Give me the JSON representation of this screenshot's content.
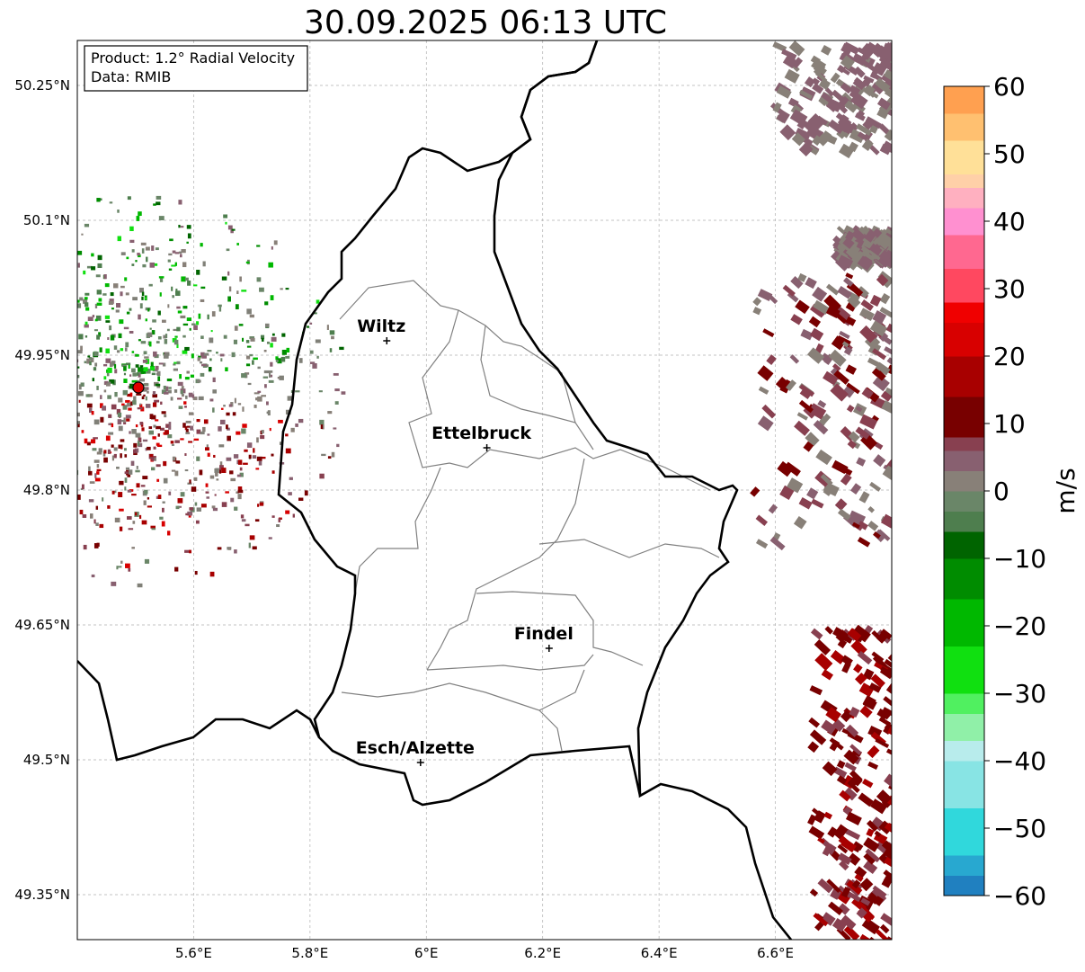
{
  "title": "30.09.2025 06:13 UTC",
  "info_box": {
    "product": "Product: 1.2° Radial Velocity",
    "data": "Data: RMIB"
  },
  "lat_ticks": [
    {
      "value": 50.25,
      "label": "50.25°N"
    },
    {
      "value": 50.1,
      "label": "50.1°N"
    },
    {
      "value": 49.95,
      "label": "49.95°N"
    },
    {
      "value": 49.8,
      "label": "49.8°N"
    },
    {
      "value": 49.65,
      "label": "49.65°N"
    },
    {
      "value": 49.5,
      "label": "49.5°N"
    },
    {
      "value": 49.35,
      "label": "49.35°N"
    }
  ],
  "lon_ticks": [
    {
      "value": 5.6,
      "label": "5.6°E"
    },
    {
      "value": 5.8,
      "label": "5.8°E"
    },
    {
      "value": 6.0,
      "label": "6°E"
    },
    {
      "value": 6.2,
      "label": "6.2°E"
    },
    {
      "value": 6.4,
      "label": "6.4°E"
    },
    {
      "value": 6.6,
      "label": "6.6°E"
    }
  ],
  "extent": {
    "lon": [
      5.4,
      6.8
    ],
    "lat": [
      49.3,
      50.3
    ]
  },
  "cities": [
    {
      "name": "Wiltz",
      "lon": 5.932,
      "lat": 49.966
    },
    {
      "name": "Ettelbruck",
      "lon": 6.104,
      "lat": 49.847
    },
    {
      "name": "Findel",
      "lon": 6.211,
      "lat": 49.624
    },
    {
      "name": "Esch/Alzette",
      "lon": 5.99,
      "lat": 49.497
    }
  ],
  "radar_site": {
    "lon": 5.505,
    "lat": 49.914
  },
  "colorbar": {
    "label": "m/s",
    "min": -60,
    "max": 60,
    "ticks": [
      {
        "value": 60,
        "label": "60"
      },
      {
        "value": 50,
        "label": "50"
      },
      {
        "value": 40,
        "label": "40"
      },
      {
        "value": 30,
        "label": "30"
      },
      {
        "value": 20,
        "label": "20"
      },
      {
        "value": 10,
        "label": "10"
      },
      {
        "value": 0,
        "label": "0"
      },
      {
        "value": -10,
        "label": "−10"
      },
      {
        "value": -20,
        "label": "−20"
      },
      {
        "value": -30,
        "label": "−30"
      },
      {
        "value": -40,
        "label": "−40"
      },
      {
        "value": -50,
        "label": "−50"
      },
      {
        "value": -60,
        "label": "−60"
      }
    ],
    "bands": [
      {
        "from": -60,
        "to": -57,
        "color": "#2080c0"
      },
      {
        "from": -57,
        "to": -54,
        "color": "#28a8d0"
      },
      {
        "from": -54,
        "to": -47,
        "color": "#30d8dc"
      },
      {
        "from": -47,
        "to": -40,
        "color": "#88e4e4"
      },
      {
        "from": -40,
        "to": -37,
        "color": "#b8ecec"
      },
      {
        "from": -37,
        "to": -33,
        "color": "#90f0a8"
      },
      {
        "from": -33,
        "to": -30,
        "color": "#50f060"
      },
      {
        "from": -30,
        "to": -23,
        "color": "#10e010"
      },
      {
        "from": -23,
        "to": -16,
        "color": "#00b800"
      },
      {
        "from": -16,
        "to": -10,
        "color": "#008c00"
      },
      {
        "from": -10,
        "to": -6,
        "color": "#006400"
      },
      {
        "from": -6,
        "to": -3,
        "color": "#4e7e4e"
      },
      {
        "from": -3,
        "to": 0,
        "color": "#6a8668"
      },
      {
        "from": 0,
        "to": 3,
        "color": "#888078"
      },
      {
        "from": 3,
        "to": 6,
        "color": "#886070"
      },
      {
        "from": 6,
        "to": 8,
        "color": "#884050"
      },
      {
        "from": 8,
        "to": 14,
        "color": "#780000"
      },
      {
        "from": 14,
        "to": 20,
        "color": "#a80000"
      },
      {
        "from": 20,
        "to": 25,
        "color": "#d80000"
      },
      {
        "from": 25,
        "to": 28,
        "color": "#f00000"
      },
      {
        "from": 28,
        "to": 33,
        "color": "#ff4860"
      },
      {
        "from": 33,
        "to": 38,
        "color": "#ff6890"
      },
      {
        "from": 38,
        "to": 42,
        "color": "#ff90d0"
      },
      {
        "from": 42,
        "to": 45,
        "color": "#ffb0c0"
      },
      {
        "from": 45,
        "to": 47,
        "color": "#ffd0a8"
      },
      {
        "from": 47,
        "to": 52,
        "color": "#ffe098"
      },
      {
        "from": 52,
        "to": 56,
        "color": "#ffc070"
      },
      {
        "from": 56,
        "to": 60,
        "color": "#ffa050"
      }
    ]
  },
  "palette": {
    "grid": "#b0b0b0",
    "border": "#000000",
    "canton": "#808080",
    "marker": "#e00000"
  }
}
